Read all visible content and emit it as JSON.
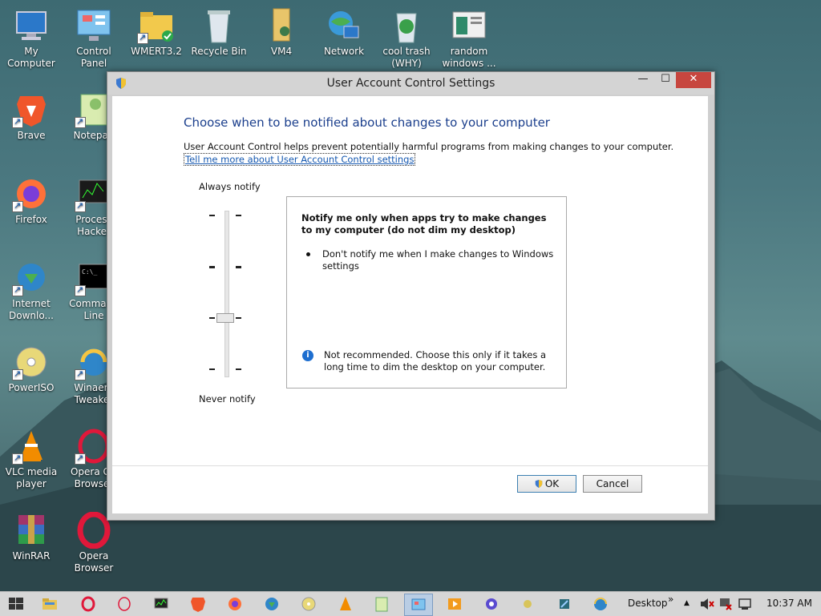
{
  "desktop": {
    "icons": [
      {
        "label": "My Computer"
      },
      {
        "label": "Control Panel"
      },
      {
        "label": "WMERT3.2"
      },
      {
        "label": "Recycle Bin"
      },
      {
        "label": "VM4"
      },
      {
        "label": "Network"
      },
      {
        "label": "cool trash (WHY)"
      },
      {
        "label": "random windows ..."
      },
      {
        "label": "Brave"
      },
      {
        "label": "Notepad"
      },
      {
        "label": "Firefox"
      },
      {
        "label": "Process Hacker"
      },
      {
        "label": "Internet Downlo..."
      },
      {
        "label": "Command Line"
      },
      {
        "label": "PowerISO"
      },
      {
        "label": "Winaero Tweaker"
      },
      {
        "label": "VLC media player"
      },
      {
        "label": "Opera GX Browser"
      },
      {
        "label": "WinRAR"
      },
      {
        "label": "Opera Browser"
      }
    ]
  },
  "window": {
    "title": "User Account Control Settings",
    "minimize": "—",
    "maximize": "☐",
    "close": "✕",
    "heading": "Choose when to be notified about changes to your computer",
    "description": "User Account Control helps prevent potentially harmful programs from making changes to your computer.",
    "link": "Tell me more about User Account Control settings",
    "slider": {
      "top_label": "Always notify",
      "bottom_label": "Never notify",
      "levels": 4,
      "selected_level": 2
    },
    "info": {
      "title": "Notify me only when apps try to make changes to my computer (do not dim my desktop)",
      "bullet": "Don't notify me when I make changes to Windows settings",
      "note": "Not recommended. Choose this only if it takes a long time to dim the desktop on your computer."
    },
    "ok_label": "OK",
    "cancel_label": "Cancel"
  },
  "taskbar": {
    "toolbar_label": "Desktop",
    "overflow": "»",
    "tray_chevron": "▲",
    "clock": "10:37 AM"
  },
  "colors": {
    "heading": "#1a3e8c",
    "link": "#1558b0",
    "close": "#c7463f"
  }
}
